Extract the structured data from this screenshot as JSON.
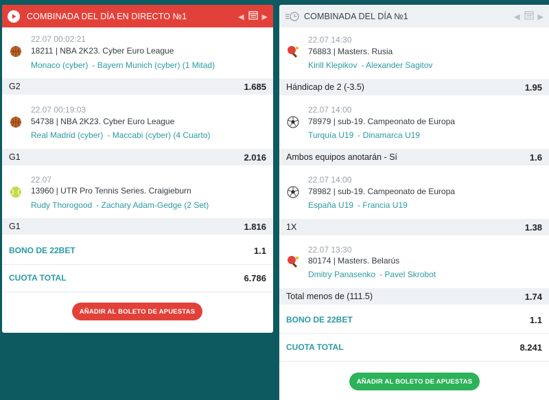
{
  "left": {
    "title": "COMBINADA DEL DÍA EN DIRECTO №1",
    "events": [
      {
        "time": "22.07 00:02:21",
        "league": "18211 | NBA 2K23. Cyber Euro League",
        "team1": "Monaco (cyber)",
        "team2": "- Bayern Munich (cyber) (1 Mitad)",
        "sport": "basketball-icon",
        "bet": "G2",
        "odd": "1.685"
      },
      {
        "time": "22.07 00:19:03",
        "league": "54738 | NBA 2K23. Cyber Euro League",
        "team1": "Real Madrid (cyber)",
        "team2": "- Maccabi (cyber) (4 Cuarto)",
        "sport": "basketball-icon",
        "bet": "G1",
        "odd": "2.016"
      },
      {
        "time": "22.07",
        "league": "13960 | UTR Pro Tennis Series. Craigieburn",
        "team1": "Rudy Thorogood",
        "team2": "- Zachary Adam-Gedge (2 Set)",
        "sport": "tennis-ball-icon",
        "bet": "G1",
        "odd": "1.816"
      }
    ],
    "bonus_label": "BONO DE 22BET",
    "bonus_value": "1.1",
    "total_label": "CUOTA TOTAL",
    "total_value": "6.786",
    "button": "AÑADIR AL BOLETO DE APUESTAS",
    "accent": "#e2413a"
  },
  "right": {
    "title": "COMBINADA DEL DÍA №1",
    "events": [
      {
        "time": "22.07 14:30",
        "league": "76883 | Masters. Rusia",
        "team1": "Kirill Klepikov",
        "team2": "- Alexander Sagitov",
        "sport": "table-tennis-icon",
        "bet": "Hándicap de 2 (-3.5)",
        "odd": "1.95"
      },
      {
        "time": "22.07 14:00",
        "league": "78979 | sub-19. Campeonato de Europa",
        "team1": "Turquía U19",
        "team2": "- Dinamarca U19",
        "sport": "soccer-ball-icon",
        "bet": "Ambos equipos anotarán - Sí",
        "odd": "1.6"
      },
      {
        "time": "22.07 14:00",
        "league": "78982 | sub-19. Campeonato de Europa",
        "team1": "España U19",
        "team2": "- Francia U19",
        "sport": "soccer-ball-icon",
        "bet": "1X",
        "odd": "1.38"
      },
      {
        "time": "22.07 13:30",
        "league": "80174 | Masters. Belarús",
        "team1": "Dmitry Panasenko",
        "team2": "- Pavel Skrobot",
        "sport": "table-tennis-icon",
        "bet": "Total menos de (111.5)",
        "odd": "1.74"
      }
    ],
    "bonus_label": "BONO DE 22BET",
    "bonus_value": "1.1",
    "total_label": "CUOTA TOTAL",
    "total_value": "8.241",
    "button": "AÑADIR AL BOLETO DE APUESTAS",
    "accent": "#2db25a"
  }
}
